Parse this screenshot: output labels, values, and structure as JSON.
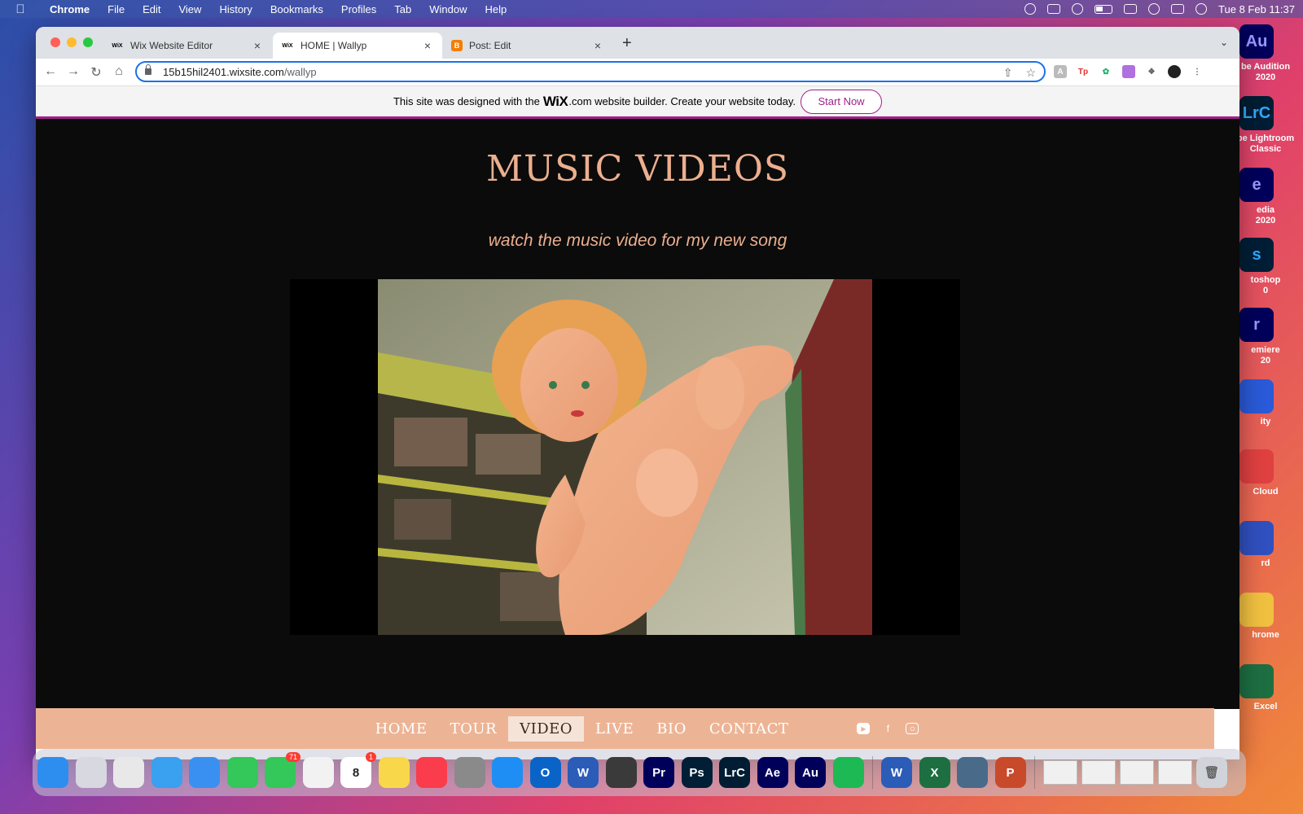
{
  "menubar": {
    "app_name": "Chrome",
    "items": [
      "File",
      "Edit",
      "View",
      "History",
      "Bookmarks",
      "Profiles",
      "Tab",
      "Window",
      "Help"
    ],
    "clock": "Tue 8 Feb  11:37"
  },
  "desktop": {
    "icons": [
      {
        "tile": "Au",
        "label": "be Audition\n2020",
        "color": "#00005b",
        "text_color": "#9999ff"
      },
      {
        "tile": "LrC",
        "label": "be Lightroom\nClassic",
        "color": "#001d34",
        "text_color": "#31a8ff"
      },
      {
        "tile": "e",
        "label": "edia\n2020",
        "color": "#00005b",
        "text_color": "#9999ff"
      },
      {
        "tile": "s",
        "label": "toshop\n0",
        "color": "#001e36",
        "text_color": "#31a8ff"
      },
      {
        "tile": "r",
        "label": "emiere\n20",
        "color": "#00005b",
        "text_color": "#9999ff"
      },
      {
        "tile": "",
        "label": "ity",
        "color": "#2a5ad8",
        "text_color": "#ffffff"
      },
      {
        "tile": "",
        "label": "Cloud",
        "color": "#e04040",
        "text_color": "#ffffff"
      },
      {
        "tile": "",
        "label": "rd",
        "color": "#3050c0",
        "text_color": "#ffffff"
      },
      {
        "tile": "",
        "label": "hrome",
        "color": "#f0c040",
        "text_color": "#ffffff"
      },
      {
        "tile": "",
        "label": "Excel",
        "color": "#1d6f42",
        "text_color": "#ffffff"
      }
    ]
  },
  "browser": {
    "tabs": [
      {
        "favicon": "WiX",
        "title": "Wix Website Editor",
        "close": "×"
      },
      {
        "favicon": "WiX",
        "title": "HOME | Wallyp",
        "close": "×"
      },
      {
        "favicon": "B",
        "title": "Post: Edit",
        "close": "×"
      }
    ],
    "new_tab": "+",
    "url_host": "15b15hil2401.wixsite.com",
    "url_path": "/wallyp"
  },
  "wix_banner": {
    "text_before": "This site was designed with the",
    "logo": "WiX",
    "text_after": ".com website builder. Create your website today.",
    "button": "Start Now"
  },
  "site": {
    "title": "MUSIC VIDEOS",
    "subtitle": "watch the music video for my new song"
  },
  "footer_nav": {
    "links": [
      "HOME",
      "TOUR",
      "VIDEO",
      "LIVE",
      "BIO",
      "CONTACT"
    ],
    "active": "VIDEO",
    "social": [
      "youtube-icon",
      "facebook-icon",
      "instagram-icon"
    ]
  },
  "dock": {
    "apps": [
      {
        "name": "finder",
        "label": "",
        "color": "#2d8ef0",
        "badge": ""
      },
      {
        "name": "launchpad",
        "label": "",
        "color": "#d8d8e0",
        "badge": ""
      },
      {
        "name": "chrome",
        "label": "",
        "color": "#e8e8e8",
        "badge": ""
      },
      {
        "name": "safari",
        "label": "",
        "color": "#3aa0f0",
        "badge": ""
      },
      {
        "name": "mail",
        "label": "",
        "color": "#3a90f0",
        "badge": ""
      },
      {
        "name": "facetime",
        "label": "",
        "color": "#34c759",
        "badge": ""
      },
      {
        "name": "messages",
        "label": "",
        "color": "#34c759",
        "badge": "71"
      },
      {
        "name": "photos",
        "label": "",
        "color": "#f2f2f2",
        "badge": ""
      },
      {
        "name": "calendar",
        "label": "8",
        "color": "#ffffff",
        "badge": "1"
      },
      {
        "name": "notes",
        "label": "",
        "color": "#f8d84a",
        "badge": ""
      },
      {
        "name": "music",
        "label": "",
        "color": "#fa3c4c",
        "badge": ""
      },
      {
        "name": "system-preferences",
        "label": "",
        "color": "#8a8a8a",
        "badge": ""
      },
      {
        "name": "app-store",
        "label": "",
        "color": "#1e8ef5",
        "badge": ""
      },
      {
        "name": "outlook",
        "label": "O",
        "color": "#0a64c8",
        "badge": ""
      },
      {
        "name": "word",
        "label": "W",
        "color": "#2b5cb8",
        "badge": ""
      },
      {
        "name": "logic",
        "label": "",
        "color": "#3a3a3a",
        "badge": ""
      },
      {
        "name": "premiere",
        "label": "Pr",
        "color": "#00005b",
        "badge": ""
      },
      {
        "name": "photoshop",
        "label": "Ps",
        "color": "#001e36",
        "badge": ""
      },
      {
        "name": "lightroom",
        "label": "LrC",
        "color": "#001d34",
        "badge": ""
      },
      {
        "name": "after-effects",
        "label": "Ae",
        "color": "#00005b",
        "badge": ""
      },
      {
        "name": "audition",
        "label": "Au",
        "color": "#00005b",
        "badge": ""
      },
      {
        "name": "spotify",
        "label": "",
        "color": "#1db954",
        "badge": ""
      }
    ],
    "recent": [
      {
        "name": "word-recent",
        "label": "W",
        "color": "#2b5cb8"
      },
      {
        "name": "excel-recent",
        "label": "X",
        "color": "#1d6f42"
      },
      {
        "name": "quicktime",
        "label": "",
        "color": "#4a6a8a"
      },
      {
        "name": "powerpoint",
        "label": "P",
        "color": "#c84a2a"
      }
    ]
  }
}
